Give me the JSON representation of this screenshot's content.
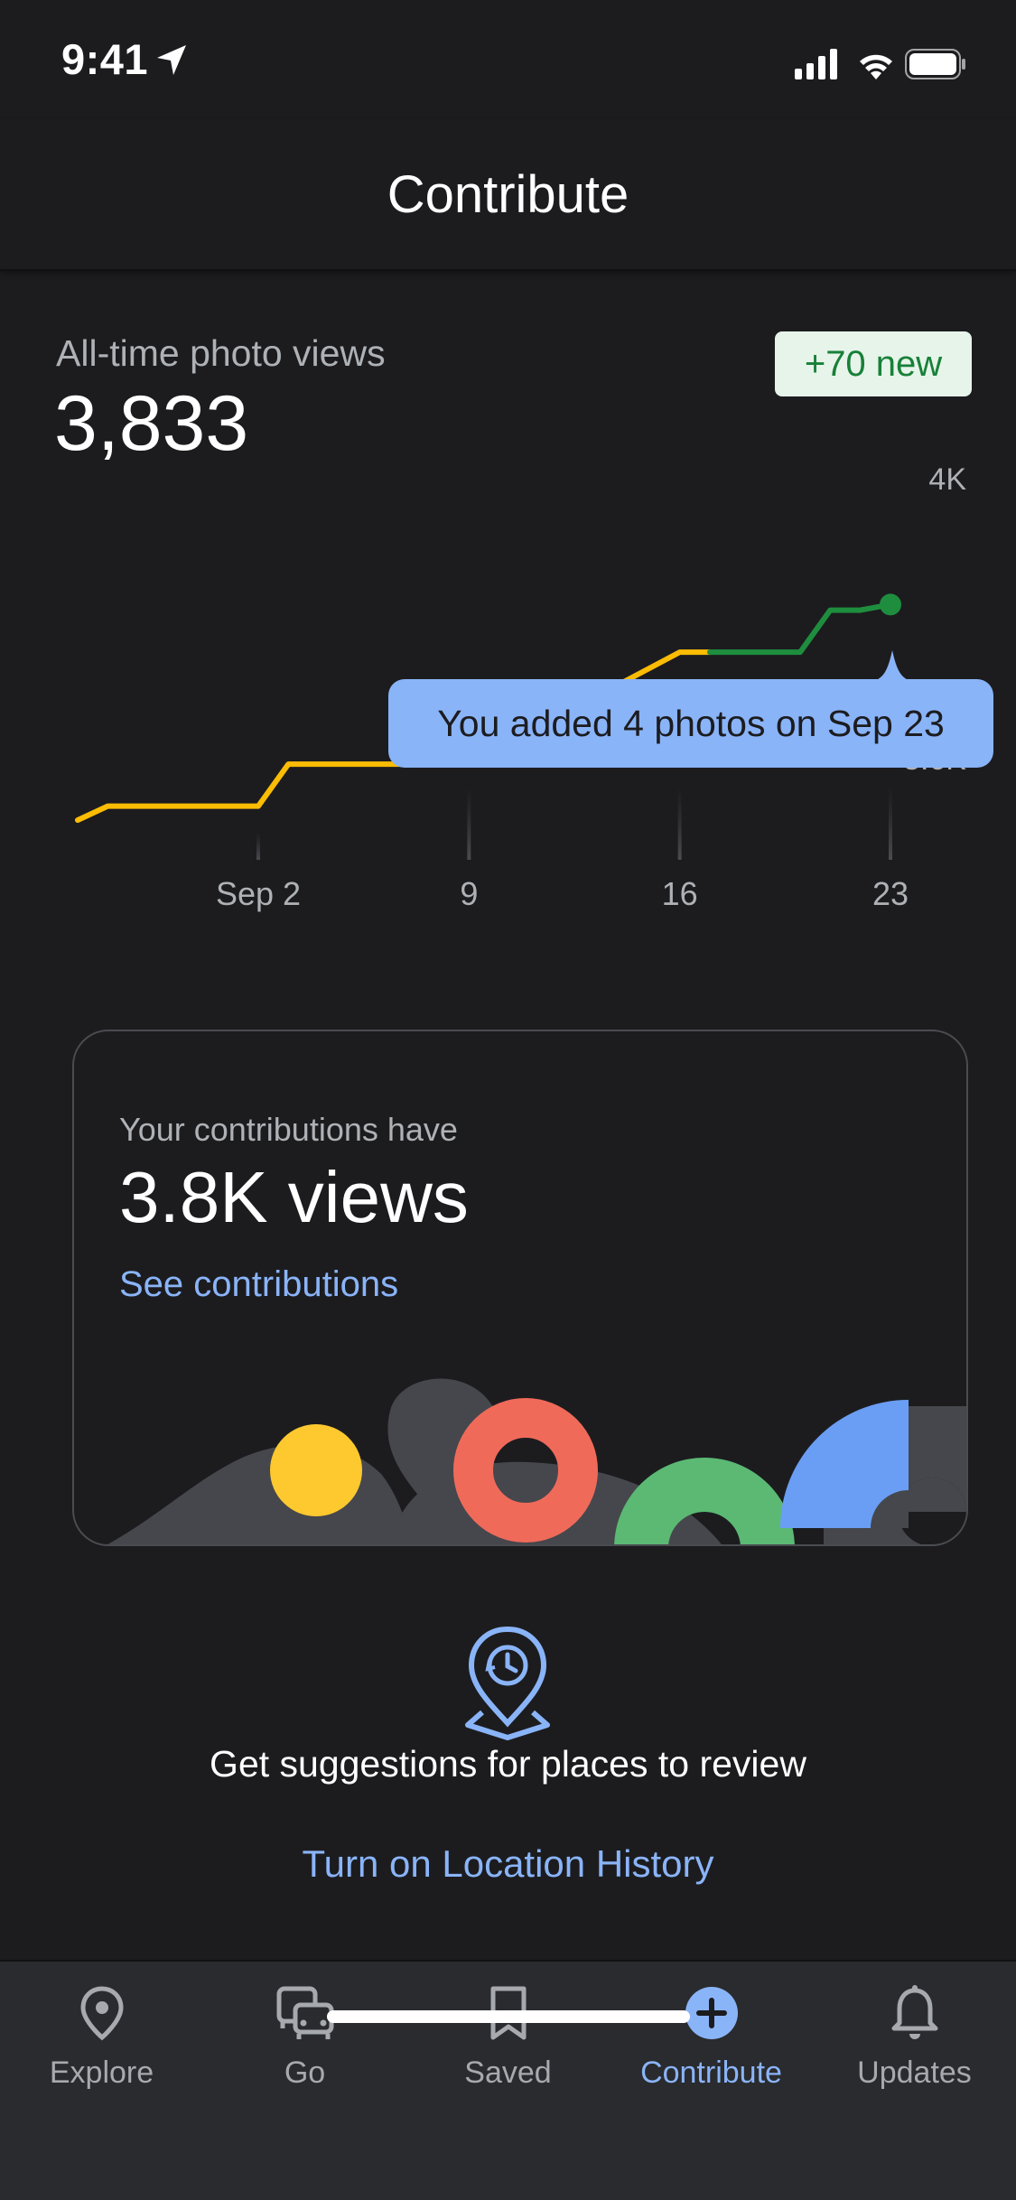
{
  "status_bar": {
    "time": "9:41"
  },
  "header": {
    "title": "Contribute"
  },
  "stats": {
    "label": "All-time photo views",
    "value": "3,833",
    "new_badge": "+70 new"
  },
  "chart_data": {
    "type": "line",
    "x_tick_labels": [
      "Sep 2",
      "9",
      "16",
      "23"
    ],
    "y_tick_labels": [
      "4K",
      "3.6K"
    ],
    "series": [
      {
        "color": "#fbbc04",
        "points": [
          {
            "day": "Aug 27",
            "y": 3525
          },
          {
            "day": "Aug 28",
            "y": 3545
          },
          {
            "day": "Sep 2",
            "y": 3545
          },
          {
            "day": "Sep 3",
            "y": 3605
          },
          {
            "day": "Sep 9",
            "y": 3605
          },
          {
            "day": "Sep 16",
            "y": 3765
          },
          {
            "day": "Sep 17",
            "y": 3765
          }
        ]
      },
      {
        "color": "#1e8e3e",
        "points": [
          {
            "day": "Sep 17",
            "y": 3765
          },
          {
            "day": "Sep 20",
            "y": 3765
          },
          {
            "day": "Sep 21",
            "y": 3825
          },
          {
            "day": "Sep 22",
            "y": 3825
          },
          {
            "day": "Sep 23",
            "y": 3833
          }
        ]
      }
    ],
    "tooltip": "You added 4 photos on Sep 23"
  },
  "contributions_card": {
    "label": "Your contributions have",
    "value": "3.8K views",
    "link": "See contributions"
  },
  "suggestions": {
    "text": "Get suggestions for places to review",
    "link": "Turn on Location History"
  },
  "nav": {
    "items": [
      {
        "label": "Explore",
        "icon": "location-pin-icon",
        "active": false
      },
      {
        "label": "Go",
        "icon": "commute-icon",
        "active": false
      },
      {
        "label": "Saved",
        "icon": "bookmark-icon",
        "active": false
      },
      {
        "label": "Contribute",
        "icon": "add-circle-icon",
        "active": true
      },
      {
        "label": "Updates",
        "icon": "bell-icon",
        "active": false
      }
    ]
  },
  "colors": {
    "background": "#1c1c1f",
    "accent_blue": "#8ab4f8",
    "yellow_series": "#fbbc04",
    "green_series": "#1e8e3e",
    "badge_bg": "#e6f4ea",
    "badge_text": "#188038"
  }
}
